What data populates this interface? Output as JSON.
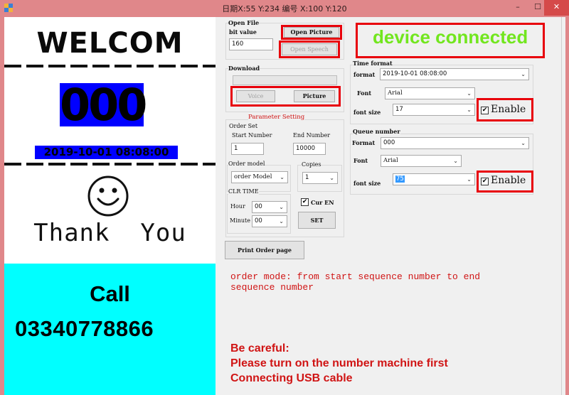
{
  "window": {
    "title": "日期X:55  Y:234 编号 X:100 Y:120",
    "minimize_glyph": "–",
    "maximize_glyph": "☐",
    "close_glyph": "✕"
  },
  "preview": {
    "welcome": "WELCOM",
    "queue_number": "000",
    "datetime": "2019-10-01 08:08:00",
    "smiley_icon": "smiley-face-icon",
    "thanks": "Thank  You",
    "call_label": "Call",
    "call_number": "03340778866",
    "colors": {
      "number_bg": "#0000ff",
      "call_bg": "#00ffff"
    }
  },
  "open_file": {
    "group_title": "Open File",
    "bit_value_label": "bit value",
    "bit_value": "160",
    "open_picture_label": "Open Picture",
    "open_speech_label": "Open Speech"
  },
  "download": {
    "group_title": "Download",
    "voice_label": "Voice",
    "picture_label": "Picture"
  },
  "parameter_setting": {
    "title": "Parameter Setting",
    "order_set_title": "Order Set",
    "start_number_label": "Start Number",
    "start_number": "1",
    "end_number_label": "End Number",
    "end_number": "10000",
    "order_model_title": "Order model",
    "order_model_value": "order Model",
    "copies_title": "Copies",
    "copies_value": "1",
    "clr_time_title": "CLR TIME",
    "hour_label": "Hour",
    "hour_value": "00",
    "minute_label": "Minute",
    "minute_value": "00",
    "cur_en_label": "Cur EN",
    "cur_en_checked": true,
    "set_label": "SET"
  },
  "print_order_label": "Print Order page",
  "status": {
    "text": "device connected",
    "color": "#72e61e"
  },
  "time_format": {
    "group_title": "Time format",
    "format_label": "format",
    "format_value": "2019-10-01 08:08:00",
    "font_label": "Font",
    "font_value": "Arial",
    "font_size_label": "font size",
    "font_size_value": "17",
    "enable_label": "Enable",
    "enable_checked": true
  },
  "queue_number": {
    "group_title": "Queue number",
    "format_label": "Format",
    "format_value": "000",
    "font_label": "Font",
    "font_value": "Arial",
    "font_size_label": "font size",
    "font_size_value": "75",
    "enable_label": "Enable",
    "enable_checked": true
  },
  "messages": {
    "order_mode_line1": "order mode: from start sequence number to end",
    "order_mode_line2": "sequence number",
    "warning_line1": "Be careful:",
    "warning_line2": "Please turn on the number machine first",
    "warning_line3": "Connecting USB cable",
    "color": "#d01414"
  },
  "icons": {
    "chevron": "⌄",
    "check": "✔"
  }
}
